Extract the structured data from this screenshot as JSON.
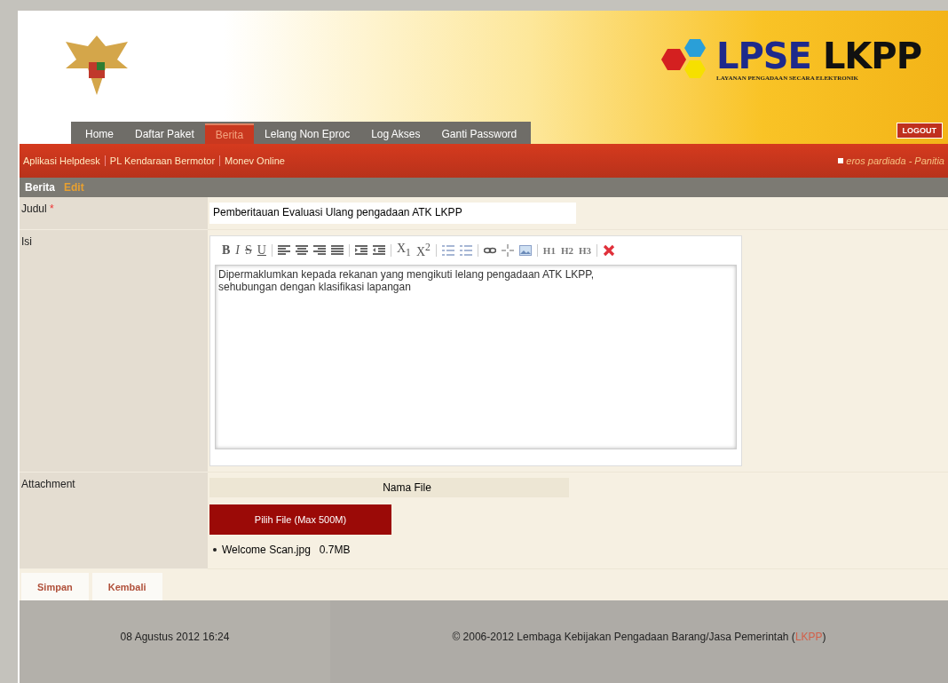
{
  "header": {
    "logo_text": "LPSE",
    "logo_text_2": "LKPP",
    "logo_subtitle": "LAYANAN PENGADAAN SECARA ELEKTRONIK",
    "logout": "LOGOUT"
  },
  "tabs": [
    {
      "label": "Home",
      "selected": false
    },
    {
      "label": "Daftar Paket",
      "selected": false
    },
    {
      "label": "Berita",
      "selected": true
    },
    {
      "label": "Lelang Non Eproc",
      "selected": false
    },
    {
      "label": "Log Akses",
      "selected": false
    },
    {
      "label": "Ganti Password",
      "selected": false
    }
  ],
  "links": [
    "Aplikasi Helpdesk",
    "PL Kendaraan Bermotor",
    "Monev Online"
  ],
  "user": "eros pardiada - Panitia",
  "breadcrumb": [
    "Berita",
    "Edit"
  ],
  "form": {
    "judul_label": "Judul",
    "required_mark": "*",
    "judul_value": "Pemberitauan Evaluasi Ulang pengadaan ATK LKPP",
    "isi_label": "Isi",
    "toolbar_groups": [
      [
        "B",
        "I",
        "S",
        "U"
      ],
      [
        "H1",
        "H2",
        "H3"
      ]
    ],
    "subsup": [
      "X$_{1}$",
      "X$^{2}$"
    ],
    "isi_value": "Dipermaklumkan kepada rekanan yang mengikuti lelang pengadaan ATK LKPP,\nsehubungan dengan klasifikasi lapangan",
    "attachment_label": "Attachment",
    "file_column": "Nama File",
    "choose_file": "Pilih File (Max 500M)",
    "files": [
      {
        "name": "Welcome Scan.jpg",
        "size": "0.7MB"
      }
    ]
  },
  "buttons": [
    "Simpan",
    "Kembali"
  ],
  "footer": {
    "date": "08 Agustus 2012 16:24",
    "copyright": "© 2006-2012 Lembaga Kebijakan Pengadaan Barang/Jasa Pemerintah (",
    "link": "LKPP",
    "close": ")"
  }
}
